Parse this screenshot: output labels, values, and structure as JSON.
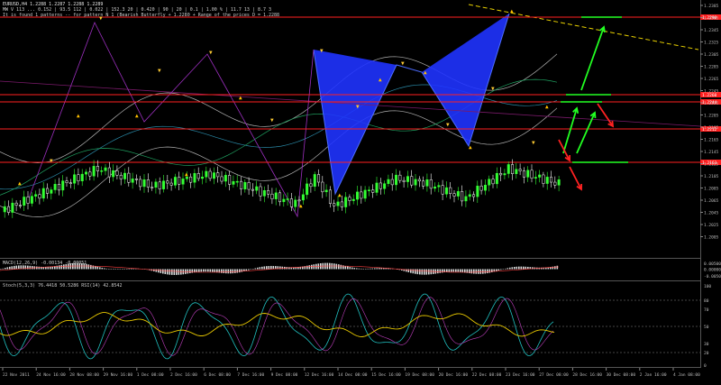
{
  "chart_info": {
    "symbol_line": "EURUSD,H4  1.2288 1.2287 1.2288 1.2289",
    "indicator_line": "MW V 113  ... 0.152 | 93.5 112 | 0.022 | 152.3 20 | 0.420 | 90 | 20 | 0.1 | 1.00 % | 11.7 13 | 8.7 3",
    "pattern_line": "It is found 1 patterns -- for pattern N 1 (Bearish Butterfly + 1.2280 + Range of the prices D = 1.2288",
    "macd_label": "MACD(12,26,9)  -0.00134  -0.00051",
    "stoch_label": "Stoch(5,3,3)  76.4418  50.5286   RSI(14)  42.8542"
  },
  "price_axis": [
    "1.2385",
    "1.2365",
    "1.2345",
    "1.2325",
    "1.2305",
    "1.2285",
    "1.2265",
    "1.2245",
    "1.2225",
    "1.2205",
    "1.2185",
    "1.2165",
    "1.2145",
    "1.2125",
    "1.2105",
    "1.2085",
    "1.2065",
    "1.2045",
    "1.2025",
    "1.2005"
  ],
  "price_levels": [
    "1.2290",
    "1.2260",
    "1.2244",
    "1.2212",
    "1.2163"
  ],
  "macd_axis": [
    "0.00500",
    "0.00000",
    "-0.00500"
  ],
  "stoch_axis": [
    "100",
    "80",
    "70",
    "50",
    "30",
    "20",
    "0"
  ],
  "time_axis": [
    "22 Nov 2011",
    "24 Nov 16:00",
    "28 Nov 08:00",
    "29 Nov 16:00",
    "1 Dec 08:00",
    "2 Dec 16:00",
    "6 Dec 08:00",
    "7 Dec 16:00",
    "9 Dec 08:00",
    "12 Dec 16:00",
    "14 Dec 08:00",
    "15 Dec 16:00",
    "19 Dec 08:00",
    "20 Dec 16:00",
    "22 Dec 08:00",
    "23 Dec 16:00",
    "27 Dec 08:00",
    "28 Dec 16:00",
    "30 Dec 08:00",
    "2 Jan 16:00",
    "4 Jan 08:00"
  ],
  "colors": {
    "background": "#000000",
    "bull_candle": "#33ff33",
    "bear_candle": "#ffffff",
    "pattern_fill": "#1f33ff",
    "level_line": "#ff2020",
    "up_arrow": "#22ff22",
    "down_arrow": "#ff2222",
    "fractal_up": "#ffc000",
    "trend_line": "#e8d000",
    "macd_hist": "#dddddd",
    "stoch_main": "#20c0c0",
    "rsi": "#e8c800"
  }
}
